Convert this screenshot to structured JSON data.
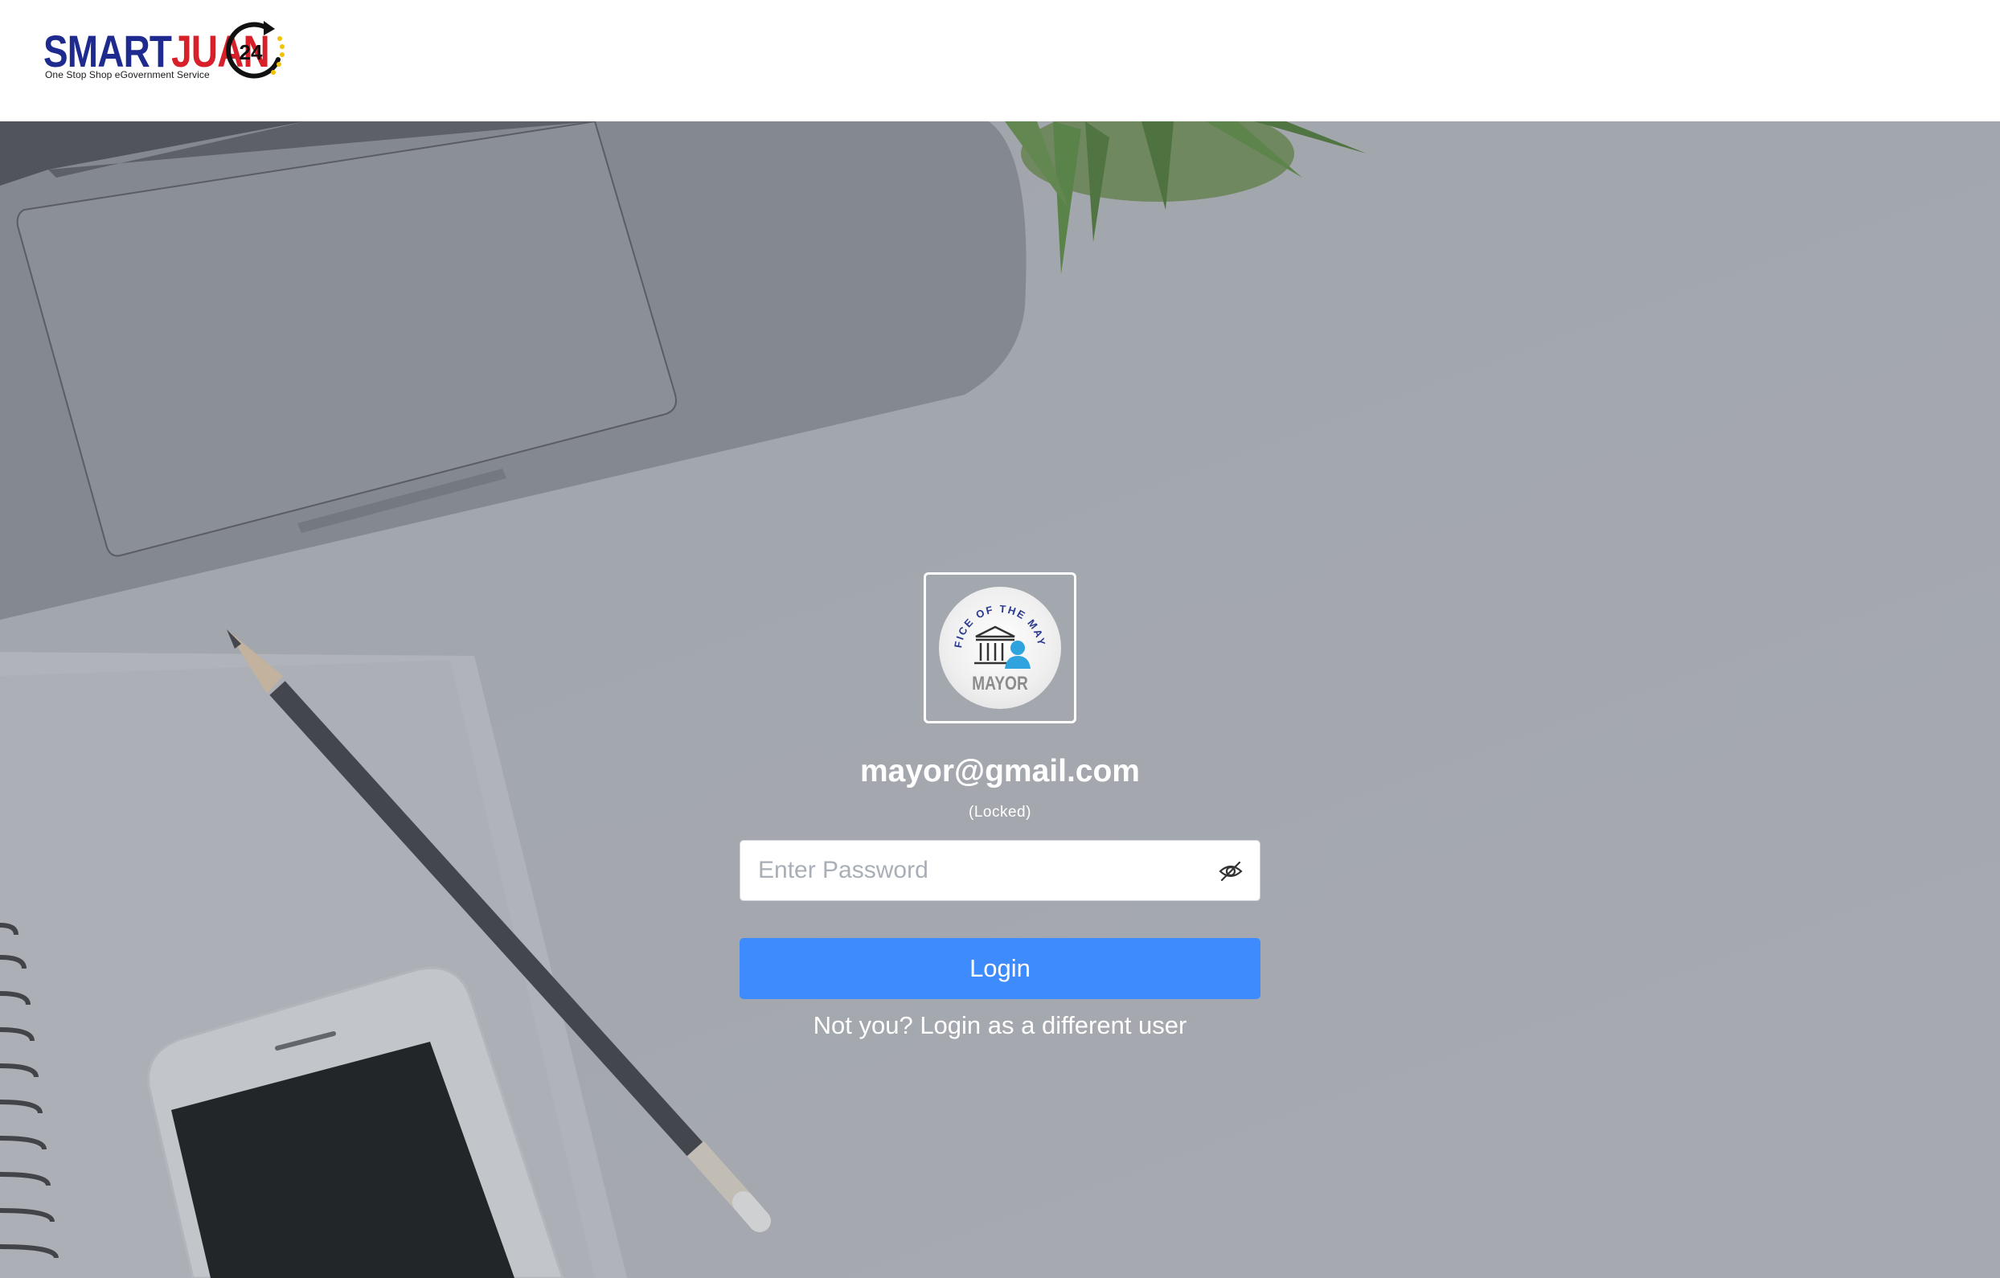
{
  "brand": {
    "logo_smart": "SMART",
    "logo_juan": "JUAN",
    "logo_number": "24",
    "tagline": "One Stop Shop eGovernment Service",
    "smart_color": "#1f2a8f",
    "juan_color": "#d7202a"
  },
  "profile": {
    "seal_top_text": "OFFICE OF THE MAYOR",
    "seal_bottom_text": "MAYOR",
    "email": "mayor@gmail.com",
    "status": "(Locked)"
  },
  "form": {
    "password_placeholder": "Enter Password",
    "password_value": "",
    "password_toggle_icon": "eye-slash-icon",
    "login_label": "Login",
    "login_color": "#3d8bfd",
    "switch_user_label": "Not you? Login as a different user"
  }
}
